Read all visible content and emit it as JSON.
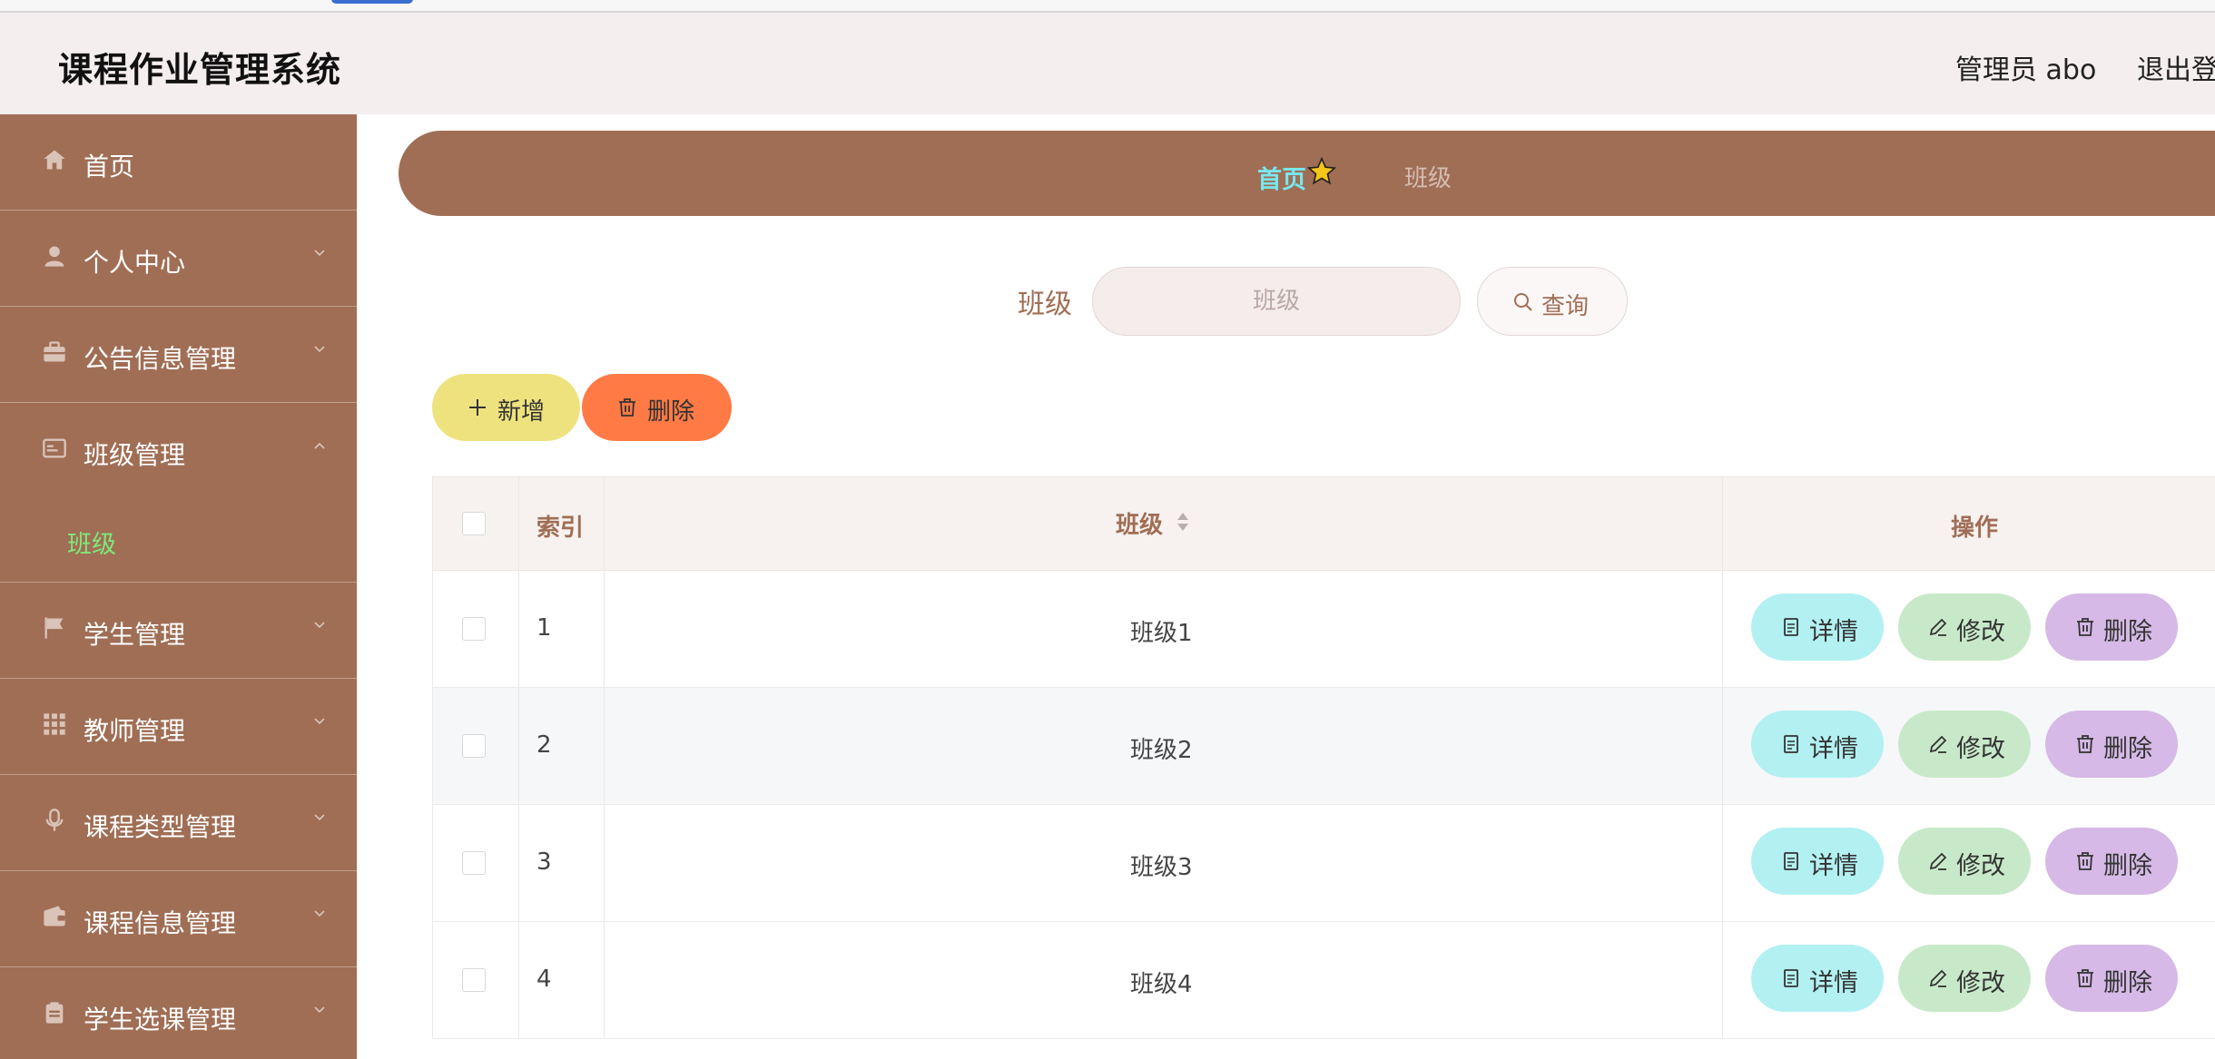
{
  "app": {
    "title": "课程作业管理系统"
  },
  "header": {
    "admin_label": "管理员 abo",
    "logout_label": "退出登"
  },
  "sidebar": {
    "items": [
      {
        "label": "首页",
        "icon": "home-icon"
      },
      {
        "label": "个人中心",
        "icon": "user-icon"
      },
      {
        "label": "公告信息管理",
        "icon": "briefcase-icon"
      },
      {
        "label": "班级管理",
        "icon": "id-card-icon",
        "expanded": true
      },
      {
        "label": "学生管理",
        "icon": "flag-icon"
      },
      {
        "label": "教师管理",
        "icon": "grid-icon"
      },
      {
        "label": "课程类型管理",
        "icon": "microphone-icon"
      },
      {
        "label": "课程信息管理",
        "icon": "wallet-icon"
      },
      {
        "label": "学生选课管理",
        "icon": "clipboard-icon"
      }
    ],
    "subitem": {
      "label": "班级"
    }
  },
  "breadcrumb": {
    "home": "首页",
    "current": "班级"
  },
  "search": {
    "label": "班级",
    "placeholder": "班级",
    "value": "",
    "button_label": "查询"
  },
  "toolbar": {
    "add_label": "新增",
    "delete_label": "删除"
  },
  "table": {
    "headers": {
      "index": "索引",
      "class": "班级",
      "actions": "操作"
    },
    "rows": [
      {
        "index": "1",
        "class": "班级1"
      },
      {
        "index": "2",
        "class": "班级2"
      },
      {
        "index": "3",
        "class": "班级3"
      },
      {
        "index": "4",
        "class": "班级4"
      }
    ],
    "actions": {
      "detail": "详情",
      "edit": "修改",
      "delete": "删除"
    }
  },
  "colors": {
    "sidebar": "#a06e55",
    "header_bg": "#f4eeee",
    "breadcrumb_home": "#78e8ef",
    "active_subitem": "#7ee87a",
    "add_button": "#eee27e",
    "delete_button": "#ff7a45",
    "detail_button": "#b2f0f1",
    "edit_button": "#c8e9c9",
    "row_delete_button": "#d6b9e6"
  }
}
